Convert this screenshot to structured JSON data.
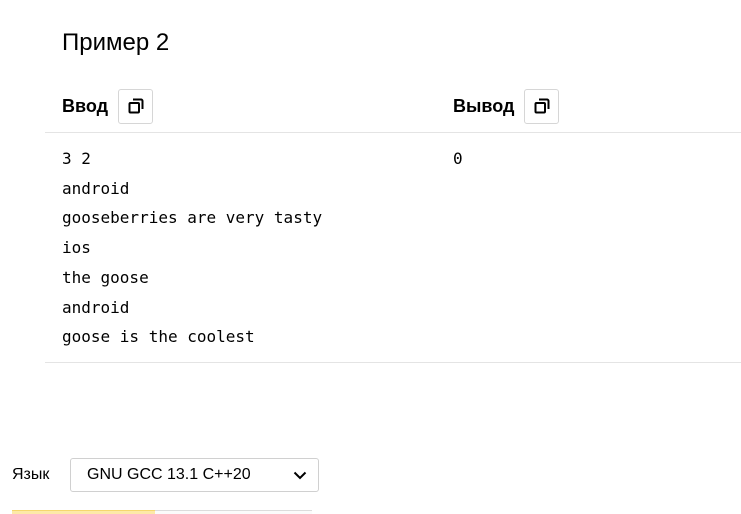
{
  "example": {
    "title": "Пример 2",
    "input_header": "Ввод",
    "output_header": "Вывод",
    "input_lines": [
      "3 2",
      "android",
      "gooseberries are very tasty",
      "ios",
      "the goose",
      "android",
      "goose is the coolest"
    ],
    "output_lines": [
      "0"
    ]
  },
  "language": {
    "label": "Язык",
    "selected": "GNU GCC 13.1 C++20"
  },
  "icons": {
    "copy": "copy-icon",
    "dropdown": "chevron-down-icon"
  },
  "colors": {
    "border": "#e4e4e4",
    "active_tab": "#fde9a8"
  }
}
